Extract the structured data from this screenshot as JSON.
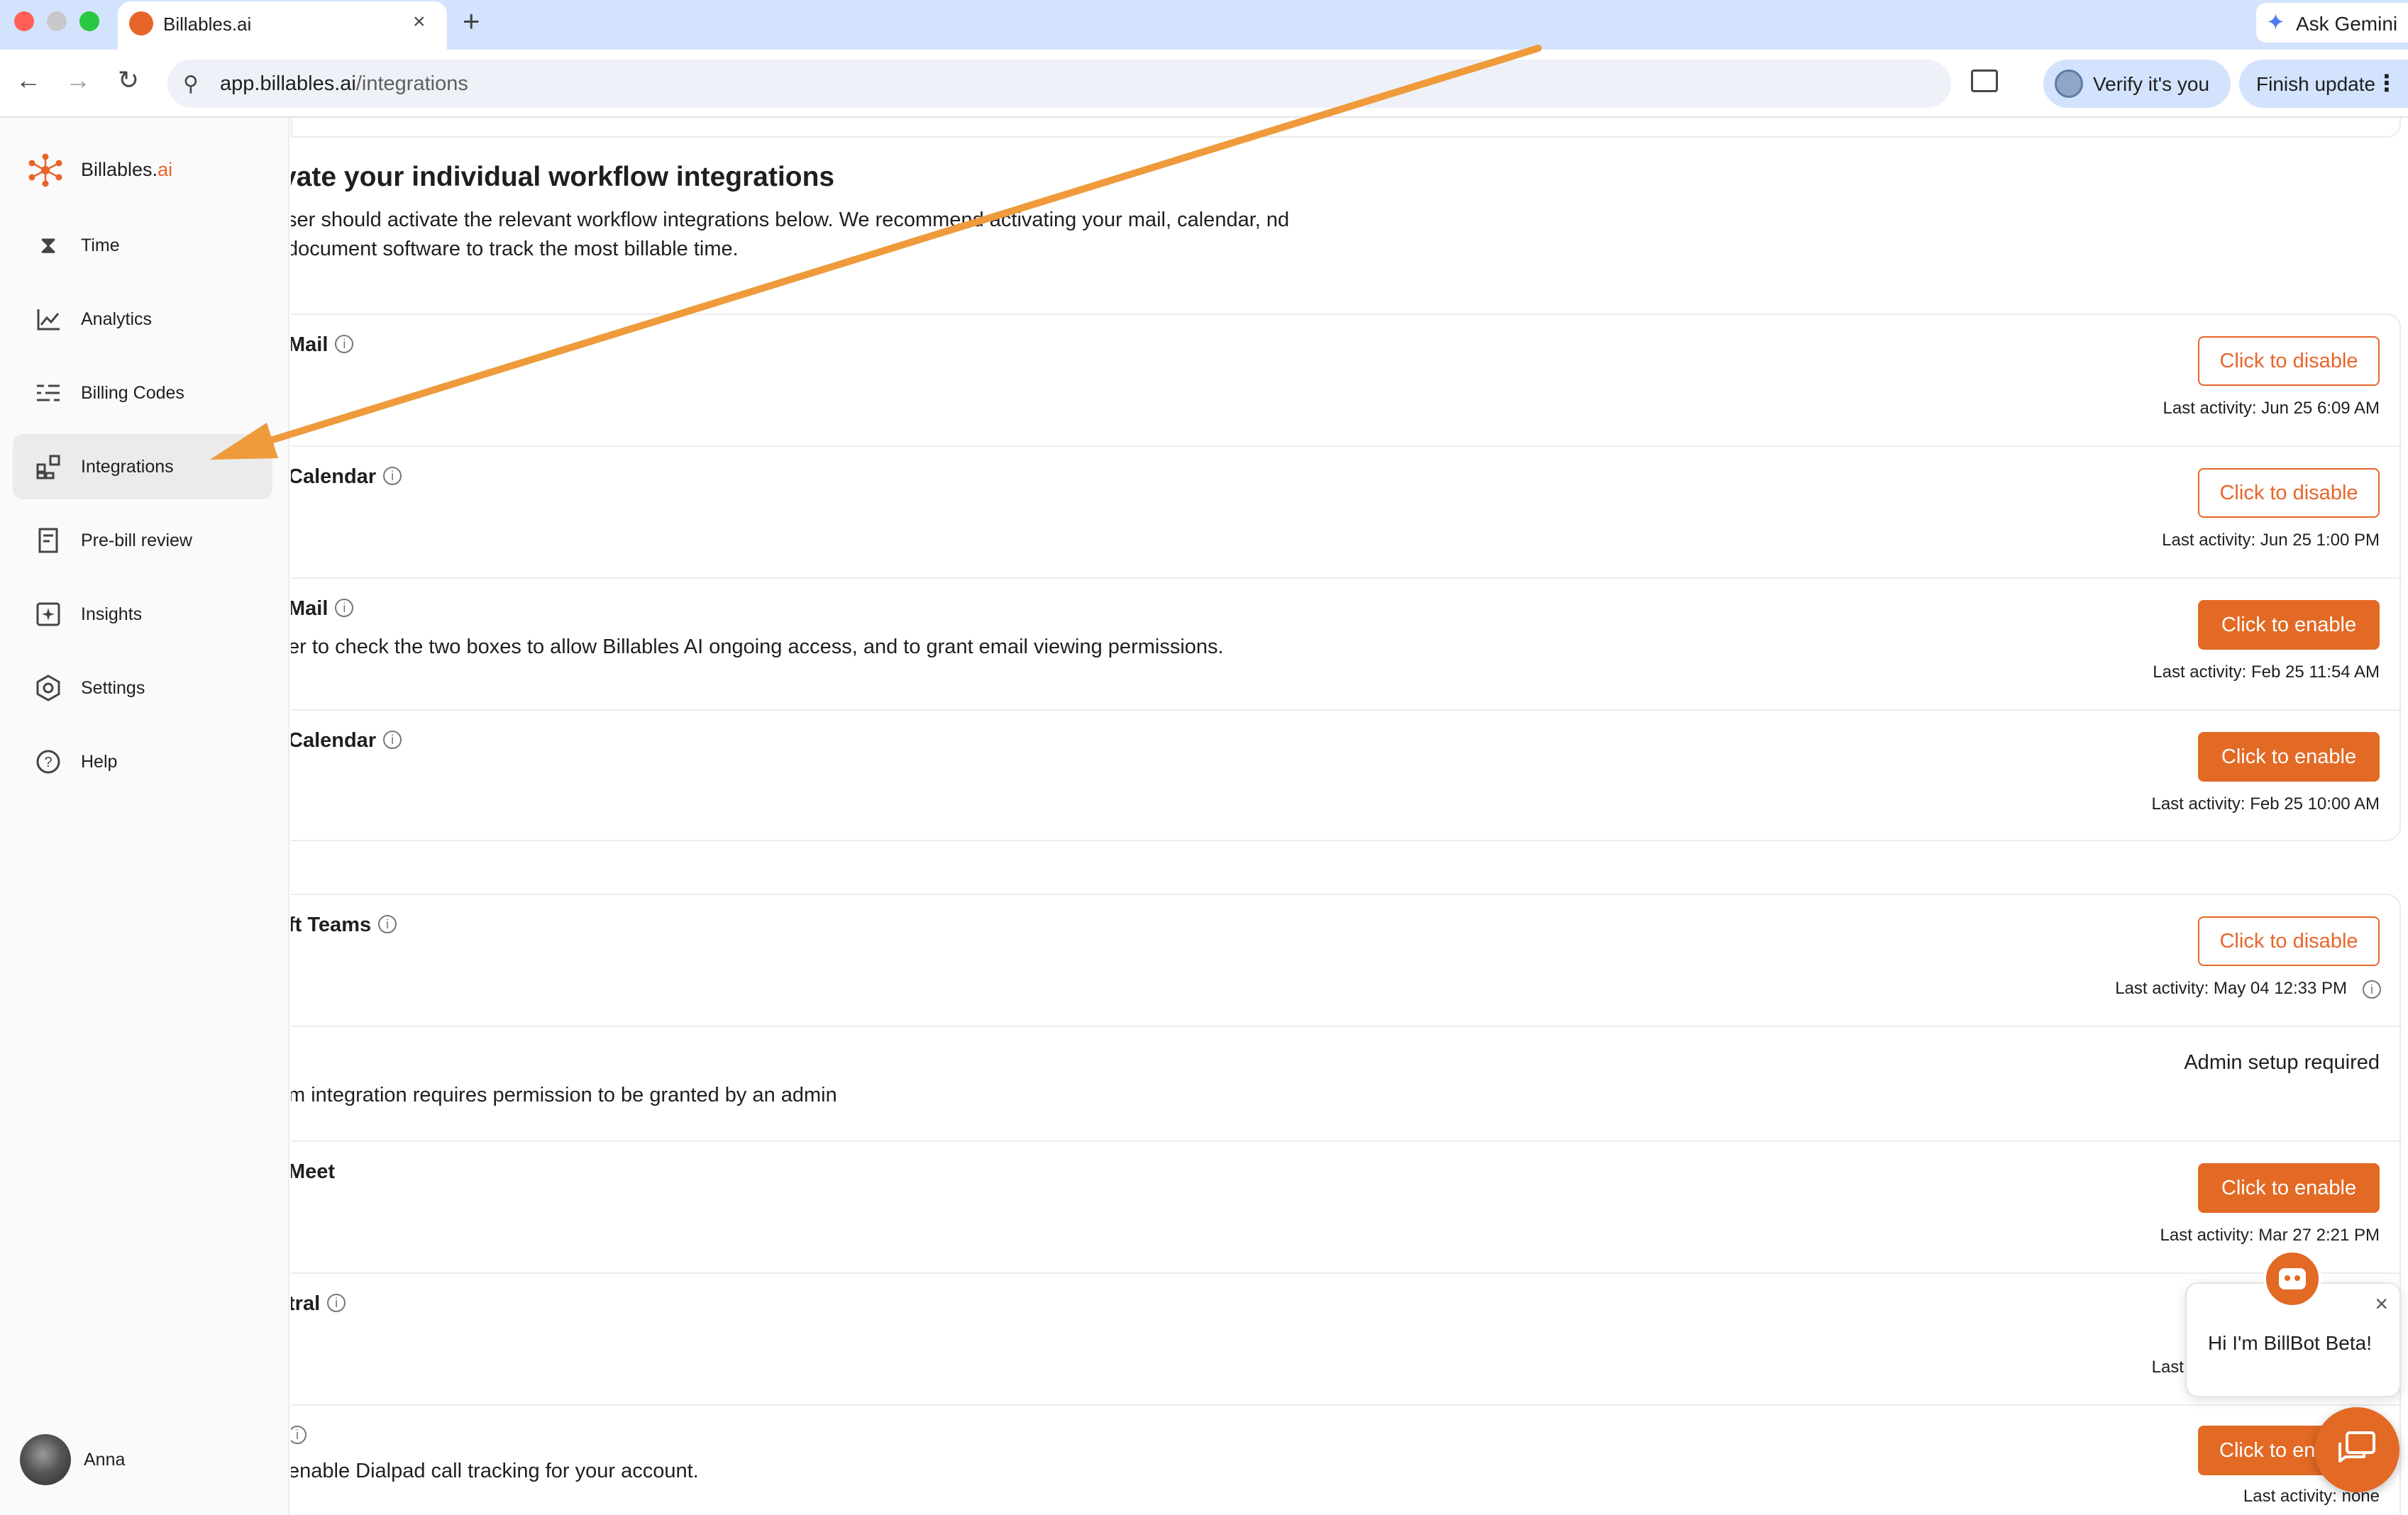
{
  "colors": {
    "accent": "#e8652a",
    "accent_fill": "#e26a25",
    "tabbar": "#d3e3fd",
    "arrow": "#ef9a3b"
  },
  "browser": {
    "tab_title": "Billables.ai",
    "new_tab_symbol": "+",
    "close_symbol": "×",
    "gemini_label": "Ask Gemini",
    "url_host": "app.billables.ai",
    "url_path": "/integrations",
    "verify_label": "Verify it's you",
    "finish_update_label": "Finish update",
    "kebab_symbol": "⋮",
    "back_symbol": "←",
    "forward_symbol": "→",
    "reload_symbol": "↻",
    "star_symbol": "☆"
  },
  "sidebar": {
    "brand_name": "Billables.",
    "brand_suffix": "ai",
    "items": [
      {
        "label": "Time",
        "icon": "hourglass-icon",
        "glyph": "⌛"
      },
      {
        "label": "Analytics",
        "icon": "line-chart-icon",
        "glyph": "📈"
      },
      {
        "label": "Billing Codes",
        "icon": "list-icon",
        "glyph": "☰"
      },
      {
        "label": "Integrations",
        "icon": "grid-plus-icon",
        "glyph": "⊞",
        "active": true
      },
      {
        "label": "Pre-bill review",
        "icon": "receipt-icon",
        "glyph": "▤"
      },
      {
        "label": "Insights",
        "icon": "sparkle-box-icon",
        "glyph": "✦"
      },
      {
        "label": "Settings",
        "icon": "gear-icon",
        "glyph": "⚙"
      },
      {
        "label": "Help",
        "icon": "help-circle-icon",
        "glyph": "?"
      }
    ],
    "user_name": "Anna"
  },
  "main": {
    "heading": "vate your individual workflow integrations",
    "description": "ser should activate the relevant workflow integrations below. We recommend activating your mail, calendar, nd document software to track the most billable time.",
    "section1": [
      {
        "title": "Mail",
        "info": true,
        "button": "Click to disable",
        "style": "outline",
        "last_activity": "Last activity: Jun 25 6:09 AM"
      },
      {
        "title": "Calendar",
        "info": true,
        "button": "Click to disable",
        "style": "outline",
        "last_activity": "Last activity: Jun 25 1:00 PM"
      },
      {
        "title": "Mail",
        "info": true,
        "desc": "er to check the two boxes to allow Billables AI ongoing access, and to grant email viewing permissions.",
        "button": "Click to enable",
        "style": "fill",
        "last_activity": "Last activity: Feb 25 11:54 AM"
      },
      {
        "title": "Calendar",
        "info": true,
        "button": "Click to enable",
        "style": "fill",
        "last_activity": "Last activity: Feb 25 10:00 AM"
      }
    ],
    "section2": [
      {
        "title": "ft Teams",
        "info": true,
        "button": "Click to disable",
        "style": "outline",
        "last_activity": "Last activity: May 04 12:33 PM"
      },
      {
        "title": "",
        "desc": "m integration requires permission to be granted by an admin",
        "admin_note": "Admin setup required"
      },
      {
        "title": "Meet",
        "button": "Click to enable",
        "style": "fill",
        "last_activity": "Last activity: Mar 27 2:21 PM"
      },
      {
        "title": "tral",
        "info": true,
        "last_activity": "Last a"
      },
      {
        "title": "",
        "info": true,
        "desc": "enable Dialpad call tracking for your account.",
        "button": "Click to en",
        "style": "fill",
        "last_activity": "Last activity: none"
      }
    ]
  },
  "billbot": {
    "greeting": "Hi I'm BillBot Beta!",
    "close_symbol": "×"
  }
}
